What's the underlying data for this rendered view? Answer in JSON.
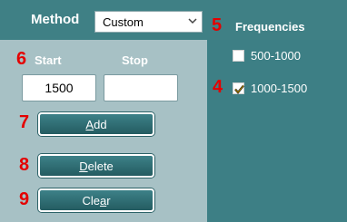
{
  "header": {
    "method_label": "Method",
    "method_selected": "Custom",
    "frequencies_label": "Frequencies"
  },
  "fields": {
    "start_label": "Start",
    "stop_label": "Stop",
    "start_value": "1500",
    "stop_value": ""
  },
  "buttons": {
    "add": {
      "pre": "",
      "u": "A",
      "post": "dd"
    },
    "delete": {
      "pre": "",
      "u": "D",
      "post": "elete"
    },
    "clear": {
      "pre": "Cle",
      "u": "a",
      "post": "r"
    }
  },
  "frequencies": [
    {
      "label": "500-1000",
      "checked": false
    },
    {
      "label": "1000-1500",
      "checked": true
    }
  ],
  "callouts": [
    "4",
    "5",
    "6",
    "7",
    "8",
    "9"
  ],
  "colors": {
    "header": "#3f8085",
    "left_panel": "#a7c1c5",
    "right_panel": "#3d7f85",
    "callout": "#e40000",
    "check": "#d4a200"
  }
}
